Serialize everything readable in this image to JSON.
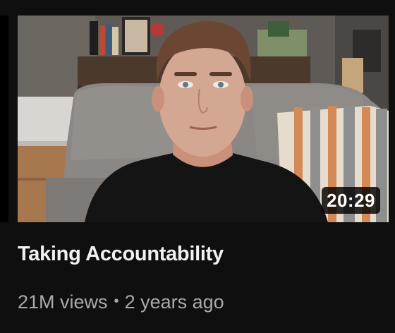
{
  "video": {
    "title": "Taking Accountability",
    "duration": "20:29",
    "views": "21M views",
    "separator": "•",
    "age": "2 years ago"
  },
  "thumbnail": {
    "subject": "man in black t-shirt seated on grey couch in living room",
    "colors": {
      "wall": "#6a6560",
      "couch": "#8a8784",
      "shirt": "#141414",
      "skin": "#d4a792",
      "hair": "#6b4632",
      "floor": "#a7774d",
      "pillow_stripe_orange": "#d48a56",
      "pillow_stripe_cream": "#e6dccd"
    }
  },
  "theme": {
    "background": "#0f0f0f",
    "title_color": "#f1f1f1",
    "meta_color": "#aaaaaa",
    "badge_bg": "#000000"
  }
}
